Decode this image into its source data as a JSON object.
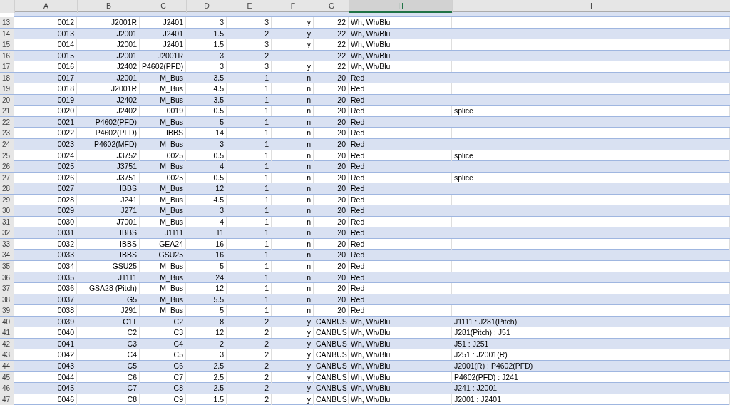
{
  "columns": [
    {
      "label": "A",
      "selected": false
    },
    {
      "label": "B",
      "selected": false
    },
    {
      "label": "C",
      "selected": false
    },
    {
      "label": "D",
      "selected": false
    },
    {
      "label": "E",
      "selected": false
    },
    {
      "label": "F",
      "selected": false
    },
    {
      "label": "G",
      "selected": false
    },
    {
      "label": "H",
      "selected": true
    },
    {
      "label": "I",
      "selected": false
    }
  ],
  "rows": [
    {
      "num": "13",
      "cells": [
        "0012",
        "J2001R",
        "J2401",
        "3",
        "3",
        "y",
        "22",
        "Wh, Wh/Blu",
        null
      ]
    },
    {
      "num": "14",
      "cells": [
        "0013",
        "J2001",
        "J2401",
        "1.5",
        "2",
        "y",
        "22",
        "Wh, Wh/Blu",
        null
      ]
    },
    {
      "num": "15",
      "cells": [
        "0014",
        "J2001",
        "J2401",
        "1.5",
        "3",
        "y",
        "22",
        "Wh, Wh/Blu",
        null
      ]
    },
    {
      "num": "16",
      "cells": [
        "0015",
        "J2001",
        "J2001R",
        "3",
        "2",
        null,
        "22",
        "Wh, Wh/Blu",
        null
      ]
    },
    {
      "num": "17",
      "cells": [
        "0016",
        "J2402",
        "P4602(PFD)",
        "3",
        "3",
        "y",
        "22",
        "Wh, Wh/Blu",
        null
      ]
    },
    {
      "num": "18",
      "cells": [
        "0017",
        "J2001",
        "M_Bus",
        "3.5",
        "1",
        "n",
        "20",
        "Red",
        null
      ]
    },
    {
      "num": "19",
      "cells": [
        "0018",
        "J2001R",
        "M_Bus",
        "4.5",
        "1",
        "n",
        "20",
        "Red",
        null
      ]
    },
    {
      "num": "20",
      "cells": [
        "0019",
        "J2402",
        "M_Bus",
        "3.5",
        "1",
        "n",
        "20",
        "Red",
        null
      ]
    },
    {
      "num": "21",
      "cells": [
        "0020",
        "J2402",
        "0019",
        "0.5",
        "1",
        "n",
        "20",
        "Red",
        "splice"
      ]
    },
    {
      "num": "22",
      "cells": [
        "0021",
        "P4602(PFD)",
        "M_Bus",
        "5",
        "1",
        "n",
        "20",
        "Red",
        null
      ]
    },
    {
      "num": "23",
      "cells": [
        "0022",
        "P4602(PFD)",
        "IBBS",
        "14",
        "1",
        "n",
        "20",
        "Red",
        null
      ]
    },
    {
      "num": "24",
      "cells": [
        "0023",
        "P4602(MFD)",
        "M_Bus",
        "3",
        "1",
        "n",
        "20",
        "Red",
        null
      ]
    },
    {
      "num": "25",
      "cells": [
        "0024",
        "J3752",
        "0025",
        "0.5",
        "1",
        "n",
        "20",
        "Red",
        "splice"
      ]
    },
    {
      "num": "26",
      "cells": [
        "0025",
        "J3751",
        "M_Bus",
        "4",
        "1",
        "n",
        "20",
        "Red",
        null
      ]
    },
    {
      "num": "27",
      "cells": [
        "0026",
        "J3751",
        "0025",
        "0.5",
        "1",
        "n",
        "20",
        "Red",
        "splice"
      ]
    },
    {
      "num": "28",
      "cells": [
        "0027",
        "IBBS",
        "M_Bus",
        "12",
        "1",
        "n",
        "20",
        "Red",
        null
      ]
    },
    {
      "num": "29",
      "cells": [
        "0028",
        "J241",
        "M_Bus",
        "4.5",
        "1",
        "n",
        "20",
        "Red",
        null
      ]
    },
    {
      "num": "30",
      "cells": [
        "0029",
        "J271",
        "M_Bus",
        "3",
        "1",
        "n",
        "20",
        "Red",
        null
      ]
    },
    {
      "num": "31",
      "cells": [
        "0030",
        "J7001",
        "M_Bus",
        "4",
        "1",
        "n",
        "20",
        "Red",
        null
      ]
    },
    {
      "num": "32",
      "cells": [
        "0031",
        "IBBS",
        "J1111",
        "11",
        "1",
        "n",
        "20",
        "Red",
        null
      ]
    },
    {
      "num": "33",
      "cells": [
        "0032",
        "IBBS",
        "GEA24",
        "16",
        "1",
        "n",
        "20",
        "Red",
        null
      ]
    },
    {
      "num": "34",
      "cells": [
        "0033",
        "IBBS",
        "GSU25",
        "16",
        "1",
        "n",
        "20",
        "Red",
        null
      ]
    },
    {
      "num": "35",
      "cells": [
        "0034",
        "GSU25",
        "M_Bus",
        "5",
        "1",
        "n",
        "20",
        "Red",
        null
      ]
    },
    {
      "num": "36",
      "cells": [
        "0035",
        "J1111",
        "M_Bus",
        "24",
        "1",
        "n",
        "20",
        "Red",
        null
      ]
    },
    {
      "num": "37",
      "cells": [
        "0036",
        "GSA28 (Pitch)",
        "M_Bus",
        "12",
        "1",
        "n",
        "20",
        "Red",
        null
      ]
    },
    {
      "num": "38",
      "cells": [
        "0037",
        "G5",
        "M_Bus",
        "5.5",
        "1",
        "n",
        "20",
        "Red",
        null
      ]
    },
    {
      "num": "39",
      "cells": [
        "0038",
        "J291",
        "M_Bus",
        "5",
        "1",
        "n",
        "20",
        "Red",
        null
      ]
    },
    {
      "num": "40",
      "cells": [
        "0039",
        "C1T",
        "C2",
        "8",
        "2",
        "y",
        "CANBUS",
        "Wh, Wh/Blu",
        "J1111 : J281(Pitch)"
      ]
    },
    {
      "num": "41",
      "cells": [
        "0040",
        "C2",
        "C3",
        "12",
        "2",
        "y",
        "CANBUS",
        "Wh, Wh/Blu",
        "J281(Pitch) : J51"
      ]
    },
    {
      "num": "42",
      "cells": [
        "0041",
        "C3",
        "C4",
        "2",
        "2",
        "y",
        "CANBUS",
        "Wh, Wh/Blu",
        "J51 : J251"
      ]
    },
    {
      "num": "43",
      "cells": [
        "0042",
        "C4",
        "C5",
        "3",
        "2",
        "y",
        "CANBUS",
        "Wh, Wh/Blu",
        "J251 : J2001(R)"
      ]
    },
    {
      "num": "44",
      "cells": [
        "0043",
        "C5",
        "C6",
        "2.5",
        "2",
        "y",
        "CANBUS",
        "Wh, Wh/Blu",
        "J2001(R) : P4602(PFD)"
      ]
    },
    {
      "num": "45",
      "cells": [
        "0044",
        "C6",
        "C7",
        "2.5",
        "2",
        "y",
        "CANBUS",
        "Wh, Wh/Blu",
        "P4602(PFD) : J241"
      ]
    },
    {
      "num": "46",
      "cells": [
        "0045",
        "C7",
        "C8",
        "2.5",
        "2",
        "y",
        "CANBUS",
        "Wh, Wh/Blu",
        "J241 : J2001"
      ]
    },
    {
      "num": "47",
      "cells": [
        "0046",
        "C8",
        "C9",
        "1.5",
        "2",
        "y",
        "CANBUS",
        "Wh, Wh/Blu",
        "J2001 : J2401"
      ]
    }
  ]
}
